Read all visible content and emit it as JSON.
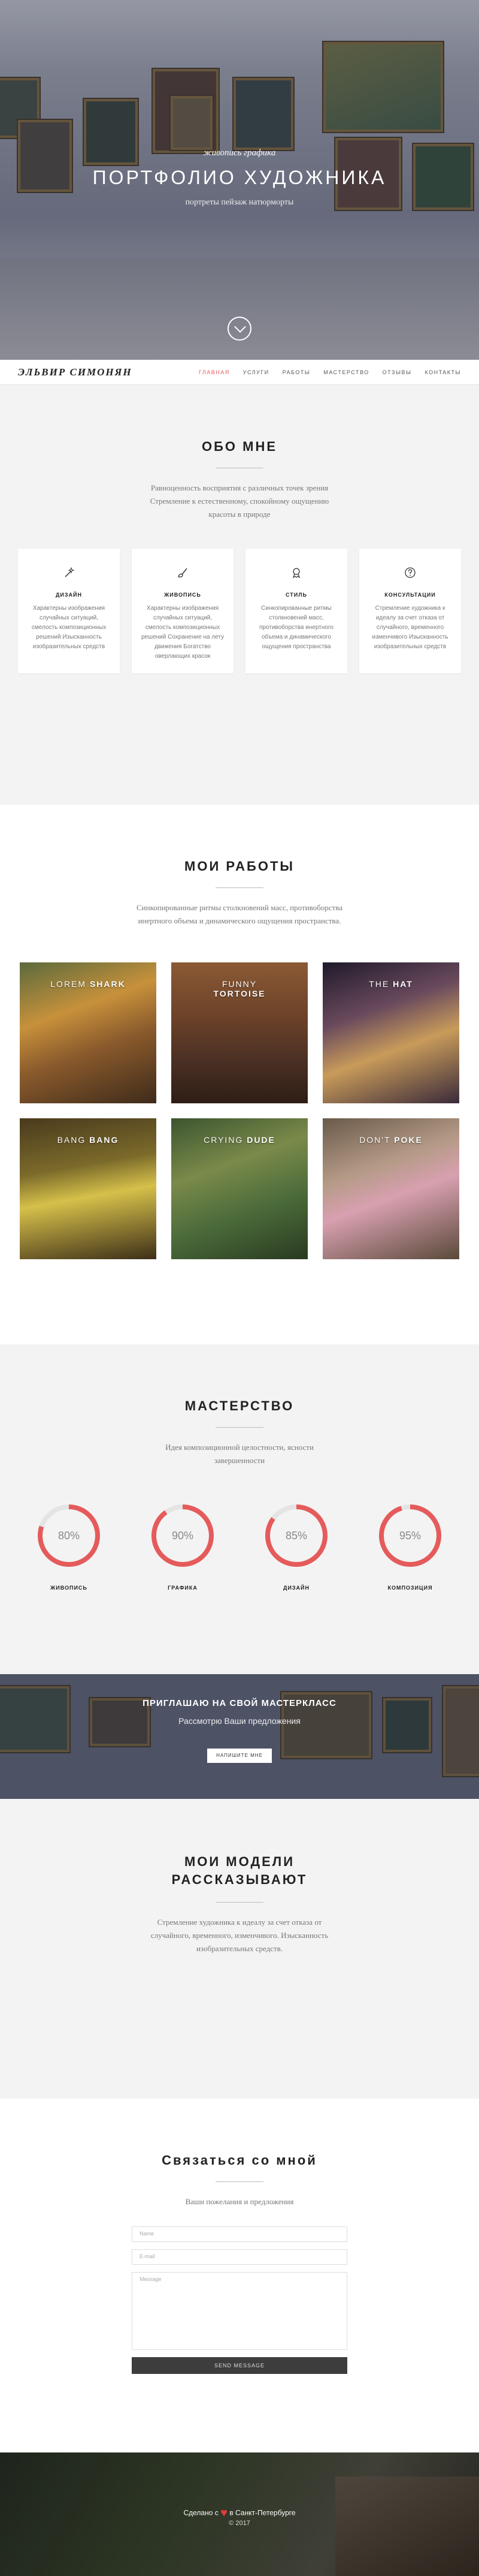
{
  "hero": {
    "pre_title": "живопись графика",
    "title": "ПОРТФОЛИО ХУДОЖНИКА",
    "subtitle": "портреты пейзаж натюрморты"
  },
  "nav": {
    "logo": "ЭЛЬВИР СИМОНЯН",
    "items": [
      "ГЛАВНАЯ",
      "УСЛУГИ",
      "РАБОТЫ",
      "МАСТЕРСТВО",
      "ОТЗЫВЫ",
      "КОНТАКТЫ"
    ]
  },
  "about": {
    "title": "ОБО МНЕ",
    "lead": "Равноценность восприятия с различных точек зрения Стремление к естественному, спокойному ощущению красоты в природе",
    "cards": [
      {
        "icon": "magic-wand-icon",
        "title": "ДИЗАЙН",
        "text": "Характерны изображения случайных ситуаций, смелость композиционных решений Изысканность изобразительных средств"
      },
      {
        "icon": "brush-icon",
        "title": "ЖИВОПИСЬ",
        "text": "Характерны изображения случайных ситуаций, смелость композиционных решений Сохранение на лету движения Богатство оверлающих красок"
      },
      {
        "icon": "award-icon",
        "title": "СТИЛЬ",
        "text": "Синкопированные ритмы столкновений масс, противоборства инертного объема и динамического ощущения пространства"
      },
      {
        "icon": "question-icon",
        "title": "КОНСУЛЬТАЦИИ",
        "text": "Стремление художника к идеалу за счет отказа от случайного, временного изменчивого Изысканность изобразительных средств"
      }
    ]
  },
  "works": {
    "title": "МОИ РАБОТЫ",
    "lead": "Синкопированные ритмы столкновений масс, противоборства инертного объема и динамического ощущения пространства.",
    "items": [
      {
        "light": "LOREM",
        "bold": "SHARK",
        "bg": "linear-gradient(160deg,#5b6a3c 0%,#c7913b 35%,#8a5a2c 60%,#3e2b1a 100%)"
      },
      {
        "light": "FUNNY",
        "bold": "TORTOISE",
        "bg": "linear-gradient(180deg,#8b5a35 0%,#6b4129 40%,#4a3024 70%,#2e1d15 100%)"
      },
      {
        "light": "THE",
        "bold": "HAT",
        "bg": "linear-gradient(160deg,#1f1a2a 0%,#6a4a5d 35%,#c89b5a 60%,#3a2a3a 100%)"
      },
      {
        "light": "BANG",
        "bold": "BANG",
        "bg": "linear-gradient(170deg,#4a3a1e 0%,#7a6a2a 35%,#d6c04a 55%,#3d2f18 100%)"
      },
      {
        "light": "CRYING",
        "bold": "DUDE",
        "bg": "linear-gradient(160deg,#3c5430 0%,#7a8a4a 35%,#4a6a3a 65%,#2a3a20 100%)"
      },
      {
        "light": "DON'T",
        "bold": "POKE",
        "bg": "linear-gradient(160deg,#6a5a4a 0%,#b49a86 35%,#d8a0b0 55%,#5a4a3a 100%)"
      }
    ]
  },
  "mastery": {
    "title": "МАСТЕРСТВО",
    "lead": "Идея композиционной целостности, ясности завершенности",
    "items": [
      {
        "value": 80,
        "label": "ЖИВОПИСЬ"
      },
      {
        "value": 90,
        "label": "ГРАФИКА"
      },
      {
        "value": 85,
        "label": "ДИЗАЙН"
      },
      {
        "value": 95,
        "label": "КОМПОЗИЦИЯ"
      }
    ],
    "accent": "#e55b5b"
  },
  "invite": {
    "title": "ПРИГЛАШАЮ НА СВОЙ МАСТЕРКЛАСС",
    "subtitle": "Рассмотрю Ваши предложения",
    "button": "НАПИШИТЕ МНЕ"
  },
  "models": {
    "title": "МОИ МОДЕЛИ РАССКАЗЫВАЮТ",
    "lead": "Стремление художника к идеалу за счет отказа от случайного, временного, изменчивого. Изысканность изобразительных средств."
  },
  "contact": {
    "title": "Связаться со мной",
    "lead": "Ваши пожелания и предложения",
    "name_placeholder": "Name",
    "email_placeholder": "E-mail",
    "message_placeholder": "Message",
    "send": "SEND MESSAGE"
  },
  "footer": {
    "made_prefix": "Сделано с",
    "made_suffix": "в Санкт-Петербурге",
    "copyright": "© 2017"
  }
}
